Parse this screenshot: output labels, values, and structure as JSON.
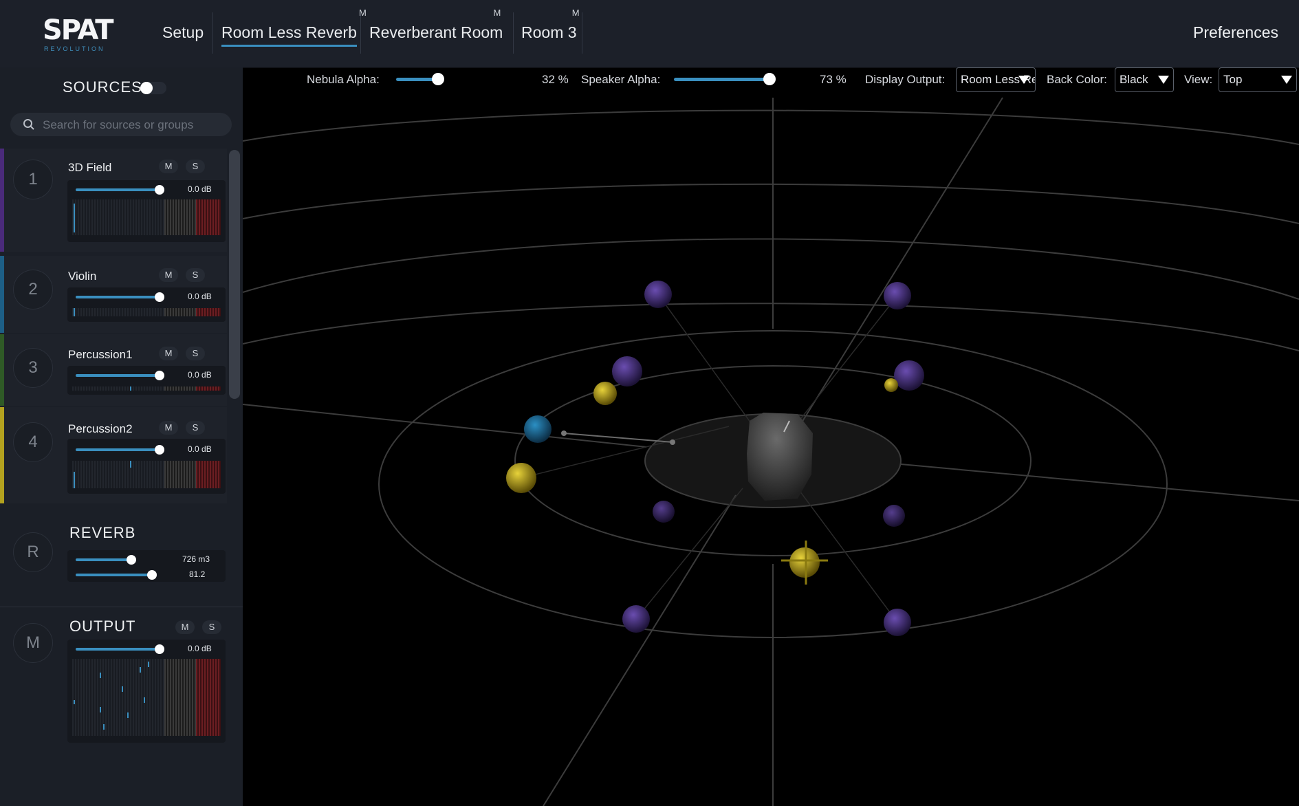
{
  "app": {
    "logo": "SPAT",
    "logo_sub": "REVOLUTION"
  },
  "tabs": [
    {
      "label": "Setup",
      "badge": ""
    },
    {
      "label": "Room Less Reverb",
      "badge": "M"
    },
    {
      "label": "Reverberant Room",
      "badge": "M"
    },
    {
      "label": "Room 3",
      "badge": "M"
    }
  ],
  "preferences_label": "Preferences",
  "sidebar": {
    "title": "SOURCES",
    "search_placeholder": "Search for sources or groups",
    "mute_label": "M",
    "solo_label": "S",
    "sources": [
      {
        "number": "1",
        "name": "3D Field",
        "gain": "0.0 dB",
        "color": "#5a2e8c"
      },
      {
        "number": "2",
        "name": "Violin",
        "gain": "0.0 dB",
        "color": "#1d5f86"
      },
      {
        "number": "3",
        "name": "Percussion1",
        "gain": "0.0 dB",
        "color": "#2f5a26"
      },
      {
        "number": "4",
        "name": "Percussion2",
        "gain": "0.0 dB",
        "color": "#b3a21f"
      }
    ],
    "reverb": {
      "number": "R",
      "title": "REVERB",
      "volume": "726 m3",
      "value2": "81.2"
    },
    "output": {
      "number": "M",
      "title": "OUTPUT",
      "gain": "0.0 dB"
    }
  },
  "viewport": {
    "nebula_alpha_label": "Nebula Alpha:",
    "nebula_alpha_value": "32 %",
    "nebula_alpha_level": 0.32,
    "speaker_alpha_label": "Speaker Alpha:",
    "speaker_alpha_value": "73 %",
    "speaker_alpha_level": 0.73,
    "display_output_label": "Display Output:",
    "display_output_value": "Room Less Reverb",
    "back_color_label": "Back Color:",
    "back_color_value": "Black",
    "view_label": "View:",
    "view_value": "Top"
  },
  "colors": {
    "accent": "#3a8fbf",
    "topbar": "#1c2029",
    "sidebar": "#1b1f27",
    "speaker": "#3d2a6e",
    "source_yellow": "#c2aa1d",
    "source_blue": "#1f6f99"
  }
}
